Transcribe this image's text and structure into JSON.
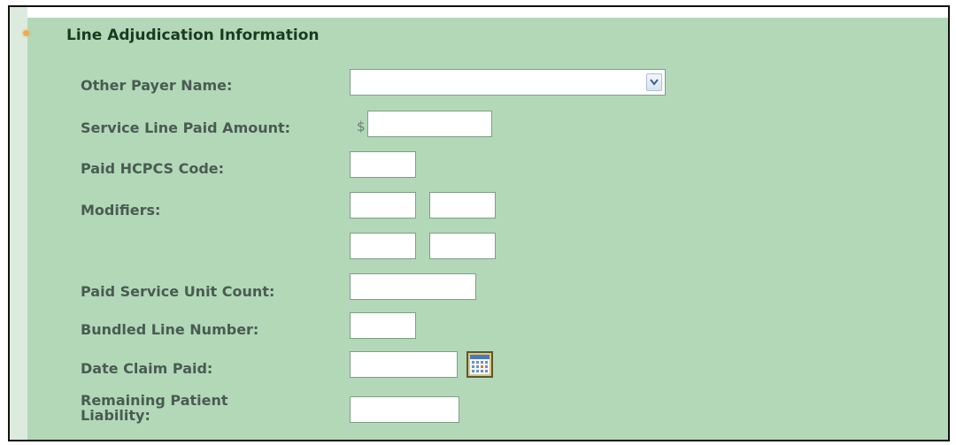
{
  "section": {
    "title": "Line Adjudication Information"
  },
  "fields": {
    "other_payer_name": {
      "label": "Other Payer Name:",
      "value": ""
    },
    "service_line_paid_amount": {
      "label": "Service Line Paid Amount:",
      "currency_symbol": "$",
      "value": ""
    },
    "paid_hcpcs_code": {
      "label": "Paid HCPCS Code:",
      "value": ""
    },
    "modifiers": {
      "label": "Modifiers:",
      "values": [
        "",
        "",
        "",
        ""
      ]
    },
    "paid_service_unit_count": {
      "label": "Paid Service Unit Count:",
      "value": ""
    },
    "bundled_line_number": {
      "label": "Bundled Line Number:",
      "value": ""
    },
    "date_claim_paid": {
      "label": "Date Claim Paid:",
      "value": "",
      "icon": "calendar-icon"
    },
    "remaining_patient_liability": {
      "label_line1": "Remaining Patient",
      "label_line2": "Liability:",
      "value": ""
    }
  },
  "colors": {
    "panel_bg": "#b2d8b8",
    "label_text": "#4a5b52",
    "title_text": "#1a3a22",
    "bullet": "#f4a94b"
  }
}
